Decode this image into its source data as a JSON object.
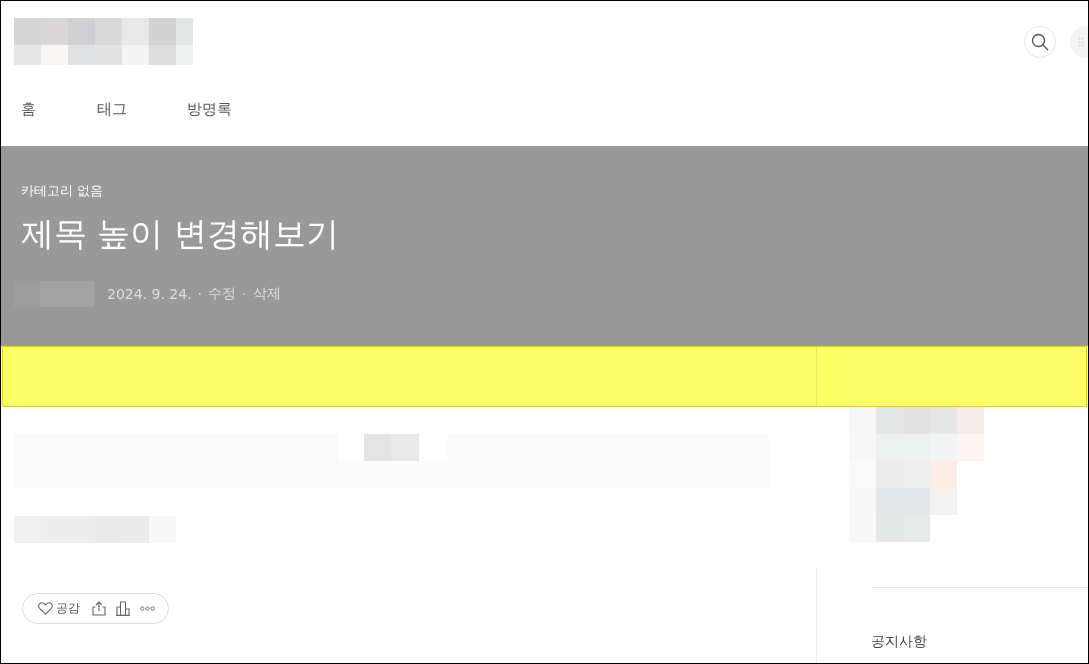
{
  "header": {
    "nav": [
      {
        "label": "홈"
      },
      {
        "label": "태그"
      },
      {
        "label": "방명록"
      }
    ]
  },
  "hero": {
    "category": "카테고리 없음",
    "title": "제목 높이 변경해보기",
    "meta": [
      {
        "kind": "date",
        "text": "2024. 9. 24."
      },
      {
        "kind": "separator",
        "text": "·"
      },
      {
        "kind": "link",
        "text": "수정"
      },
      {
        "kind": "separator",
        "text": "·"
      },
      {
        "kind": "link",
        "text": "삭제"
      }
    ]
  },
  "reactions": {
    "like_label": "공감"
  },
  "sidebar": {
    "heading": "공지사항"
  }
}
